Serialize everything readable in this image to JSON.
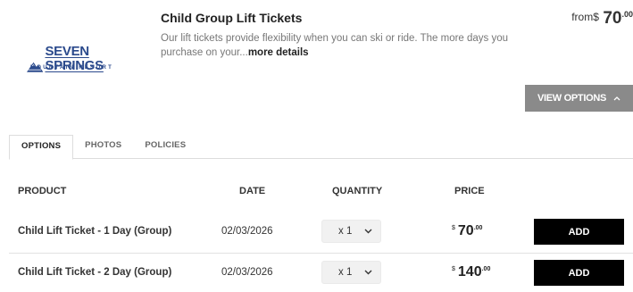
{
  "logo": {
    "name": "SEVEN SPRINGS",
    "sub": "MOUNTAIN RESORT"
  },
  "product": {
    "title": "Child Group Lift Tickets",
    "description": "Our lift tickets provide flexibility when you can ski or ride. The more days you purchase on your...",
    "more_link": "more details"
  },
  "from_price": {
    "label": "from",
    "currency": "$",
    "amount": "70",
    "cents": ".00"
  },
  "view_options": {
    "label": "VIEW OPTIONS"
  },
  "tabs": [
    {
      "label": "OPTIONS",
      "active": true
    },
    {
      "label": "PHOTOS",
      "active": false
    },
    {
      "label": "POLICIES",
      "active": false
    }
  ],
  "table": {
    "headers": {
      "product": "PRODUCT",
      "date": "DATE",
      "quantity": "QUANTITY",
      "price": "PRICE"
    },
    "rows": [
      {
        "name": "Child Lift Ticket - 1 Day (Group)",
        "date": "02/03/2026",
        "quantity": "x 1",
        "currency": "$",
        "amount": "70",
        "cents": ".00",
        "button": "ADD"
      },
      {
        "name": "Child Lift Ticket - 2 Day (Group)",
        "date": "02/03/2026",
        "quantity": "x 1",
        "currency": "$",
        "amount": "140",
        "cents": ".00",
        "button": "ADD"
      }
    ]
  },
  "colors": {
    "brand": "#2b4a8c",
    "button_dark": "#000000",
    "button_gray": "#8a8a8a"
  },
  "icons": {
    "logo_mark": "mountain-logo-icon",
    "view_options": "chevron-up-icon",
    "quantity": "chevron-down-icon"
  }
}
